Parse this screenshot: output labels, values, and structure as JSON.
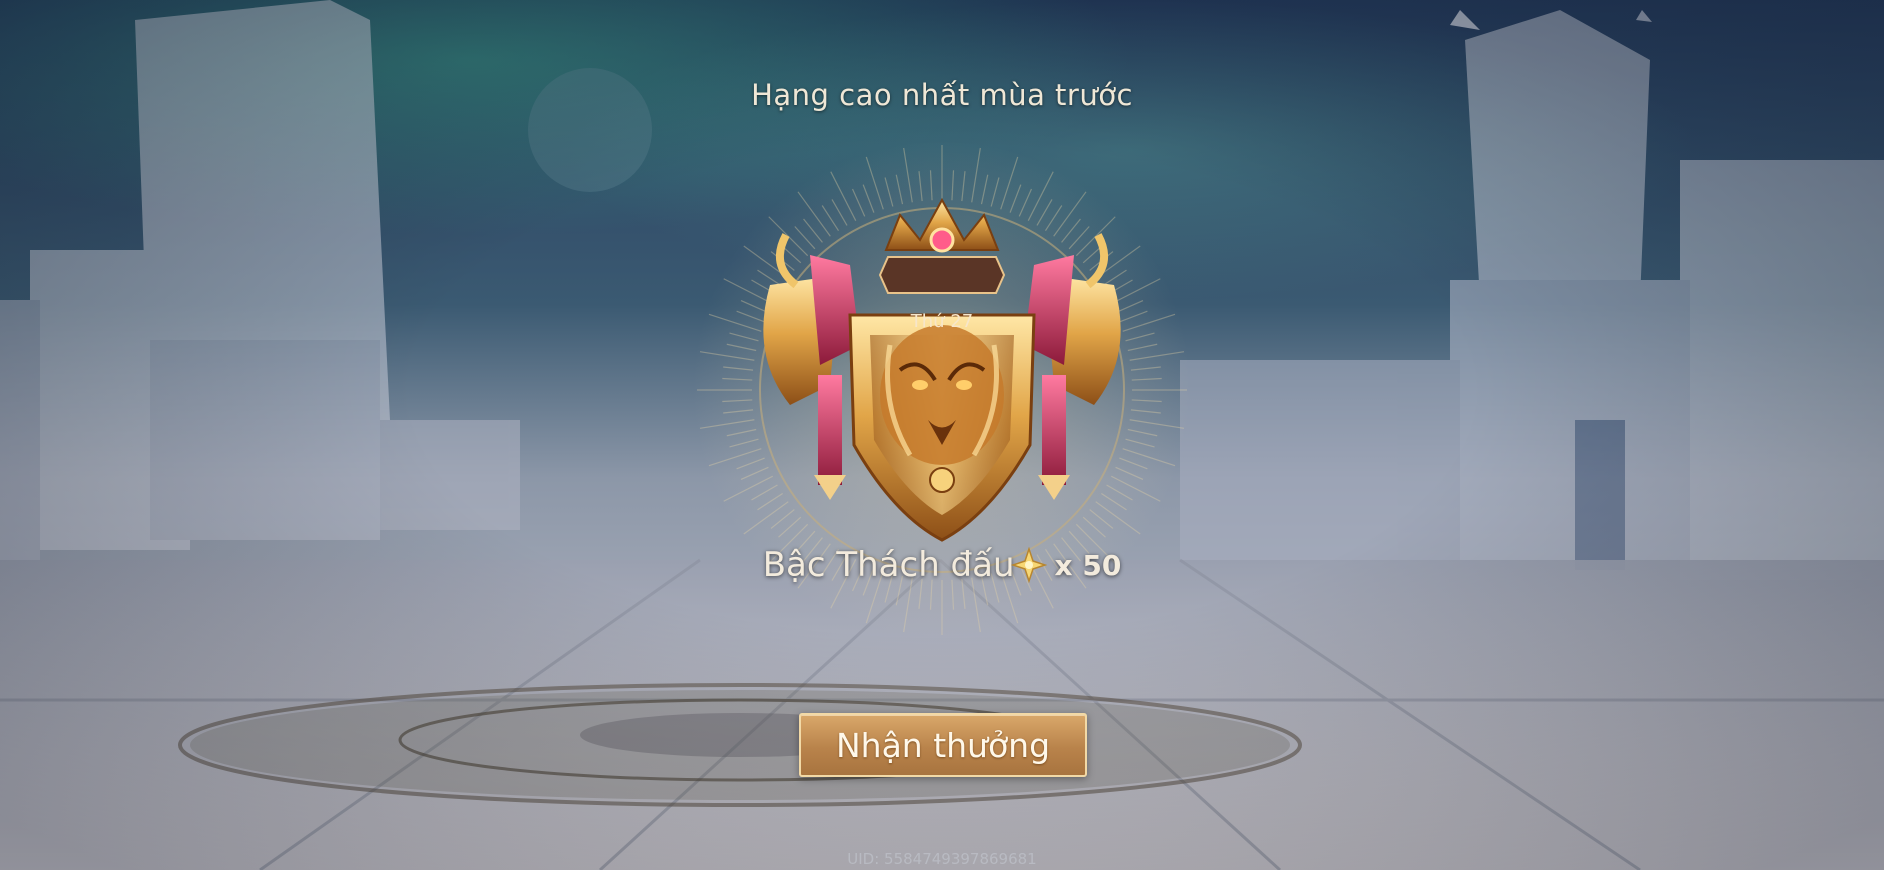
{
  "screen": {
    "title": "Hạng cao nhất mùa trước",
    "rank_badge": "Thứ 27",
    "rank_name": "Bậc Thách đấu",
    "reward_icon": "star-crystal-icon",
    "reward_count": "x 50",
    "claim_label": "Nhận thưởng",
    "uid": "UID: 5584749397869681"
  },
  "colors": {
    "accent_gold": "#d9a86a",
    "crest_red": "#c8325a",
    "text_cream": "#efe7d6"
  }
}
